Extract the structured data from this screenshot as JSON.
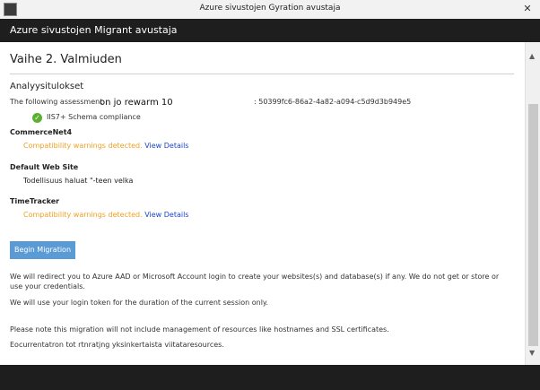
{
  "window": {
    "title": "Azure sivustojen Gyration avustaja",
    "close_glyph": "✕"
  },
  "header": {
    "title": "Azure sivustojen Migrant avustaja"
  },
  "step": {
    "title": "Vaihe 2. Valmiuden"
  },
  "results": {
    "section_label": "Analyysitulokset",
    "assessment_prefix": "The following assessment",
    "assessment_overlay": "on jo rewarm 10",
    "assessment_id": ": 50399fc6-86a2-4a82-a094-c5d9d3b949e5",
    "schema_check": "IIS7+ Schema compliance",
    "check_icon": "check-circle-icon"
  },
  "sites": [
    {
      "name": "CommerceNet4",
      "status": "Compatibility warnings detected.",
      "link": "View Details"
    },
    {
      "name": "Default Web Site",
      "note": "Todellisuus haluat \"-teen velka"
    },
    {
      "name": "TimeTracker",
      "status": "Compatibility warnings detected.",
      "link": "View Details"
    }
  ],
  "actions": {
    "begin_migration": "Begin Migration"
  },
  "notes": {
    "redirect": "We will redirect you to Azure AAD or Microsoft Account login to create your websites(s) and database(s) if any. We do not get or store or use your credentials.",
    "token": "We will use your login token for the duration of the current session only.",
    "management": "Please note this migration will not include management of resources like hostnames and SSL certificates.",
    "simple": "Eocurrentatron tot rtnratjng yksinkertaista viitataresources."
  },
  "colors": {
    "warning": "#f0a020",
    "link": "#1a44c8",
    "button": "#5b9bd5",
    "header": "#1e1e1e",
    "check": "#5cb030"
  }
}
